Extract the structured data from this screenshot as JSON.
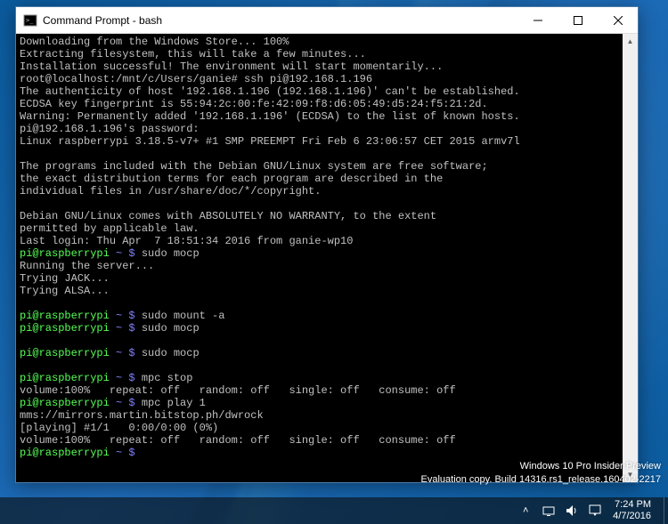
{
  "window": {
    "title": "Command Prompt - bash",
    "lines": [
      [
        [
          "w",
          "Downloading from the Windows Store... 100%"
        ]
      ],
      [
        [
          "w",
          "Extracting filesystem, this will take a few minutes..."
        ]
      ],
      [
        [
          "w",
          "Installation successful! The environment will start momentarily..."
        ]
      ],
      [
        [
          "w",
          "root@localhost:/mnt/c/Users/ganie# ssh pi@192.168.1.196"
        ]
      ],
      [
        [
          "w",
          "The authenticity of host '192.168.1.196 (192.168.1.196)' can't be established."
        ]
      ],
      [
        [
          "w",
          "ECDSA key fingerprint is 55:94:2c:00:fe:42:09:f8:d6:05:49:d5:24:f5:21:2d."
        ]
      ],
      [
        [
          "w",
          "Warning: Permanently added '192.168.1.196' (ECDSA) to the list of known hosts."
        ]
      ],
      [
        [
          "w",
          "pi@192.168.1.196's password:"
        ]
      ],
      [
        [
          "w",
          "Linux raspberrypi 3.18.5-v7+ #1 SMP PREEMPT Fri Feb 6 23:06:57 CET 2015 armv7l"
        ]
      ],
      [
        [
          "w",
          ""
        ]
      ],
      [
        [
          "w",
          "The programs included with the Debian GNU/Linux system are free software;"
        ]
      ],
      [
        [
          "w",
          "the exact distribution terms for each program are described in the"
        ]
      ],
      [
        [
          "w",
          "individual files in /usr/share/doc/*/copyright."
        ]
      ],
      [
        [
          "w",
          ""
        ]
      ],
      [
        [
          "w",
          "Debian GNU/Linux comes with ABSOLUTELY NO WARRANTY, to the extent"
        ]
      ],
      [
        [
          "w",
          "permitted by applicable law."
        ]
      ],
      [
        [
          "w",
          "Last login: Thu Apr  7 18:51:34 2016 from ganie-wp10"
        ]
      ],
      [
        [
          "g",
          "pi@raspberrypi"
        ],
        [
          "w",
          " "
        ],
        [
          "b",
          "~ $"
        ],
        [
          "w",
          " sudo mocp"
        ]
      ],
      [
        [
          "w",
          "Running the server..."
        ]
      ],
      [
        [
          "w",
          "Trying JACK..."
        ]
      ],
      [
        [
          "w",
          "Trying ALSA..."
        ]
      ],
      [
        [
          "w",
          ""
        ]
      ],
      [
        [
          "g",
          "pi@raspberrypi"
        ],
        [
          "w",
          " "
        ],
        [
          "b",
          "~ $"
        ],
        [
          "w",
          " sudo mount -a"
        ]
      ],
      [
        [
          "g",
          "pi@raspberrypi"
        ],
        [
          "w",
          " "
        ],
        [
          "b",
          "~ $"
        ],
        [
          "w",
          " sudo mocp"
        ]
      ],
      [
        [
          "w",
          ""
        ]
      ],
      [
        [
          "g",
          "pi@raspberrypi"
        ],
        [
          "w",
          " "
        ],
        [
          "b",
          "~ $"
        ],
        [
          "w",
          " sudo mocp"
        ]
      ],
      [
        [
          "w",
          ""
        ]
      ],
      [
        [
          "g",
          "pi@raspberrypi"
        ],
        [
          "w",
          " "
        ],
        [
          "b",
          "~ $"
        ],
        [
          "w",
          " mpc stop"
        ]
      ],
      [
        [
          "w",
          "volume:100%   repeat: off   random: off   single: off   consume: off"
        ]
      ],
      [
        [
          "g",
          "pi@raspberrypi"
        ],
        [
          "w",
          " "
        ],
        [
          "b",
          "~ $"
        ],
        [
          "w",
          " mpc play 1"
        ]
      ],
      [
        [
          "w",
          "mms://mirrors.martin.bitstop.ph/dwrock"
        ]
      ],
      [
        [
          "w",
          "[playing] #1/1   0:00/0:00 (0%)"
        ]
      ],
      [
        [
          "w",
          "volume:100%   repeat: off   random: off   single: off   consume: off"
        ]
      ],
      [
        [
          "g",
          "pi@raspberrypi"
        ],
        [
          "w",
          " "
        ],
        [
          "b",
          "~ $"
        ],
        [
          "w",
          " "
        ]
      ]
    ]
  },
  "watermark": {
    "line1": "Windows 10 Pro Insider Preview",
    "line2": "Evaluation copy. Build 14316.rs1_release.160402-2217"
  },
  "tray": {
    "chevron": "˄",
    "time": "7:24 PM",
    "date": "4/7/2016"
  }
}
